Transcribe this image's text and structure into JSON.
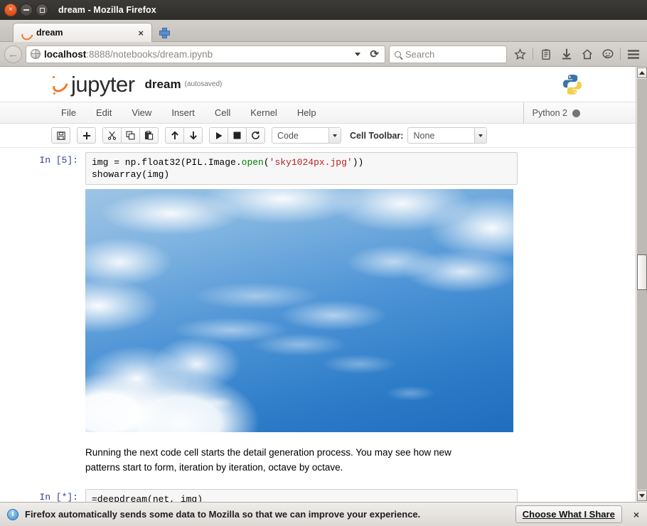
{
  "window": {
    "title": "dream - Mozilla Firefox",
    "controls": {
      "close": "×",
      "minimize": "–",
      "maximize": "□"
    }
  },
  "tabs": [
    {
      "title": "dream",
      "favicon": "jupyter-icon",
      "close_label": "×"
    }
  ],
  "newtab_label": "+",
  "navbar": {
    "back_label": "←",
    "url_host": "localhost",
    "url_path": ":8888/notebooks/dream.ipynb",
    "url_full": "localhost:8888/notebooks/dream.ipynb",
    "reload_label": "⟳",
    "dropdown_label": "▾",
    "search_placeholder": "Search",
    "icons": [
      "bookmark-star-icon",
      "reader-list-icon",
      "download-icon",
      "home-icon",
      "chat-icon",
      "hamburger-menu-icon"
    ]
  },
  "jupyter": {
    "logo_text": "jupyter",
    "notebook_name": "dream",
    "save_state": "(autosaved)",
    "kernel_logo": "python-logo",
    "menu": [
      "File",
      "Edit",
      "View",
      "Insert",
      "Cell",
      "Kernel",
      "Help"
    ],
    "kernel": {
      "name": "Python 2",
      "status": "busy-dot"
    },
    "toolbar": {
      "buttons": [
        {
          "name": "save-button",
          "glyph": "💾",
          "title": "Save"
        },
        {
          "name": "insert-cell-below-button",
          "glyph": "+",
          "title": "Insert cell below"
        },
        {
          "name": "cut-cell-button",
          "glyph": "✂",
          "title": "Cut cell"
        },
        {
          "name": "copy-cell-button",
          "glyph": "⧉",
          "title": "Copy cell"
        },
        {
          "name": "paste-cell-button",
          "glyph": "📋",
          "title": "Paste cell"
        },
        {
          "name": "move-cell-up-button",
          "glyph": "↑",
          "title": "Move up"
        },
        {
          "name": "move-cell-down-button",
          "glyph": "↓",
          "title": "Move down"
        },
        {
          "name": "run-cell-button",
          "glyph": "▶",
          "title": "Run"
        },
        {
          "name": "interrupt-kernel-button",
          "glyph": "■",
          "title": "Interrupt"
        },
        {
          "name": "restart-kernel-button",
          "glyph": "⟳",
          "title": "Restart"
        }
      ],
      "cell_type_value": "Code",
      "cell_toolbar_label": "Cell Toolbar:",
      "cell_toolbar_value": "None"
    }
  },
  "notebook": {
    "cells": [
      {
        "prompt": "In [5]:",
        "line1_a": "img = np.float32(PIL.Image.",
        "line1_fn": "open",
        "line1_b": "(",
        "line1_str": "'sky1024px.jpg'",
        "line1_c": "))",
        "line2": "showarray(img)"
      }
    ],
    "output_image_alt": "sky-photograph-output",
    "markdown_line1": "Running the next code cell starts the detail generation process. You may see how new",
    "markdown_line2": "patterns start to form, iteration by iteration, octave by octave.",
    "running_cell": {
      "prompt": "In [*]:",
      "code": "=deepdream(net, img)"
    }
  },
  "scrollbar": {
    "up_label": "▲",
    "down_label": "▼"
  },
  "notification": {
    "icon": "info-icon",
    "icon_glyph": "i",
    "message": "Firefox automatically sends some data to Mozilla so that we can improve your experience.",
    "action_label": "Choose What I Share",
    "close_label": "×"
  },
  "colors": {
    "accent_orange": "#f37726",
    "link_blue": "#303f9f",
    "string_red": "#ba2121",
    "function_green": "#008000",
    "sky_blue": "#2d7cc8"
  }
}
